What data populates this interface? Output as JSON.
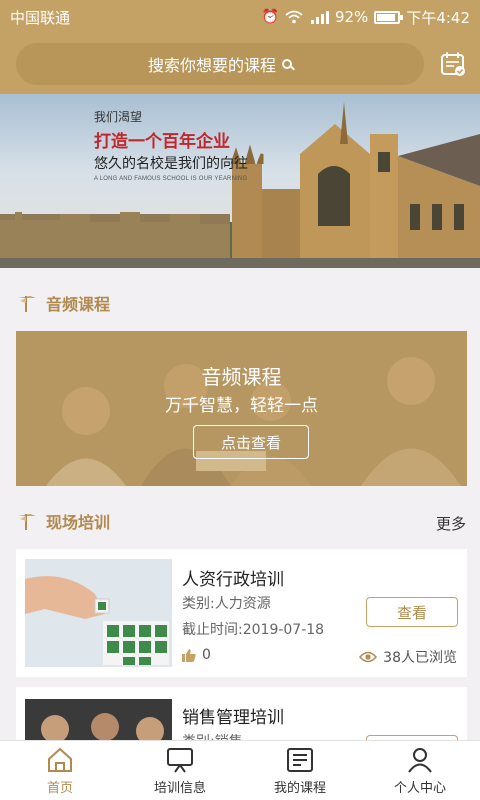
{
  "status_bar": {
    "carrier": "中国联通",
    "battery": "92%",
    "time": "下午4:42",
    "battery_level": 0.92
  },
  "header": {
    "search_placeholder": "搜索你想要的课程",
    "calendar_icon": "calendar-check-icon"
  },
  "banner": {
    "line1": "我们渴望",
    "line2": "打造一个百年企业",
    "line3": "悠久的名校是我们的向往",
    "line4": "A LONG AND FAMOUS SCHOOL IS OUR YEARNING"
  },
  "audio_section": {
    "title": "音频课程",
    "card_title": "音频课程",
    "card_subtitle": "万千智慧，轻轻一点",
    "card_button": "点击查看"
  },
  "training_section": {
    "title": "现场培训",
    "more": "更多",
    "items": [
      {
        "name": "人资行政培训",
        "category": "类别:人力资源",
        "deadline": "截止时间:2019-07-18",
        "likes": "0",
        "views": "38人已浏览",
        "button": "查看"
      },
      {
        "name": "销售管理培训",
        "category": "类别:销售",
        "button": "查看"
      }
    ]
  },
  "tabbar": {
    "tabs": [
      {
        "label": "首页",
        "icon": "home-icon",
        "active": true
      },
      {
        "label": "培训信息",
        "icon": "presentation-icon",
        "active": false
      },
      {
        "label": "我的课程",
        "icon": "courses-icon",
        "active": false
      },
      {
        "label": "个人中心",
        "icon": "user-icon",
        "active": false
      }
    ]
  },
  "colors": {
    "accent": "#c4a265",
    "accent_dark": "#b08a4e",
    "background": "#f2f0f3"
  }
}
